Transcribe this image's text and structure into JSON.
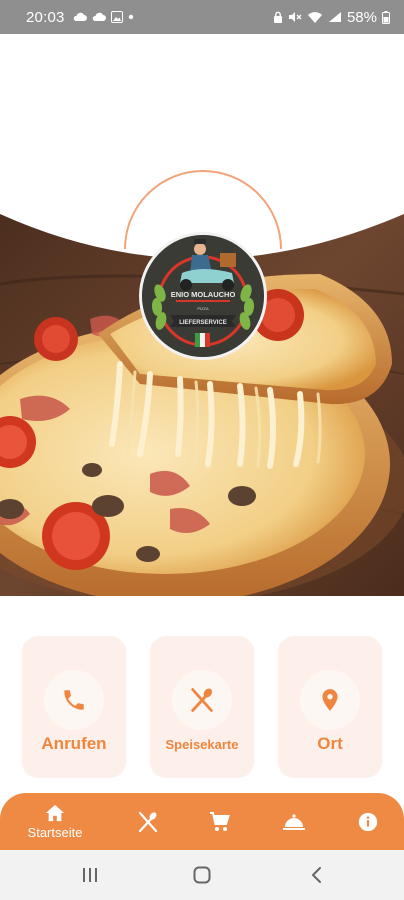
{
  "status_bar": {
    "time": "20:03",
    "battery": "58%"
  },
  "logo": {
    "text_top": "ENIO MOLAUCHO",
    "text_small": "PIZZA",
    "text_banner": "LIEFERSERVICE"
  },
  "actions": [
    {
      "label": "Anrufen",
      "icon": "phone-icon"
    },
    {
      "label": "Speisekarte",
      "icon": "utensils-icon"
    },
    {
      "label": "Ort",
      "icon": "location-pin-icon"
    }
  ],
  "bottom_nav": {
    "items": [
      {
        "label": "Startseite",
        "icon": "home-icon",
        "active": true
      },
      {
        "label": "",
        "icon": "utensils-icon"
      },
      {
        "label": "",
        "icon": "cart-icon"
      },
      {
        "label": "",
        "icon": "cloche-icon"
      },
      {
        "label": "",
        "icon": "info-icon"
      }
    ]
  },
  "colors": {
    "accent": "#ef8a45",
    "card_bg": "#fdf0ea",
    "status_bar": "#8f8f8f",
    "system_nav": "#f2f2f2"
  }
}
